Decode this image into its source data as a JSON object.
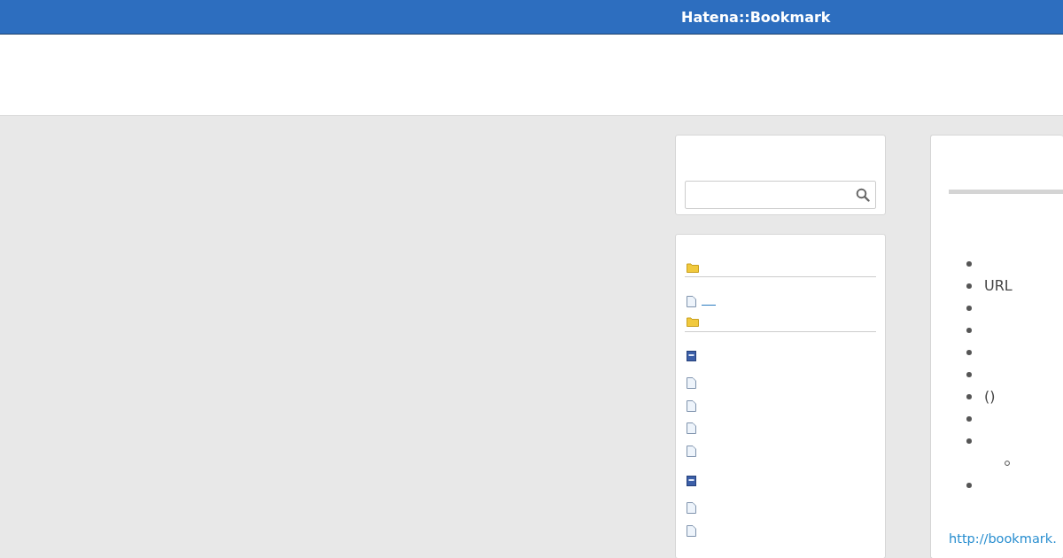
{
  "header": {
    "title": "Hatena::Bookmark"
  },
  "search": {
    "kind": "search"
  },
  "sidebar": {
    "items": [
      {
        "kind": "folder"
      },
      {
        "kind": "page",
        "link": true
      },
      {
        "kind": "folder"
      },
      {
        "kind": "book"
      },
      {
        "kind": "page"
      },
      {
        "kind": "page"
      },
      {
        "kind": "page"
      },
      {
        "kind": "page"
      },
      {
        "kind": "book"
      },
      {
        "kind": "page"
      },
      {
        "kind": "page"
      }
    ]
  },
  "main": {
    "bullets": [
      {
        "kind": "empty"
      },
      {
        "kind": "text",
        "text": "URL"
      },
      {
        "kind": "empty"
      },
      {
        "kind": "empty"
      },
      {
        "kind": "empty"
      },
      {
        "kind": "empty"
      },
      {
        "kind": "text",
        "text": "()"
      },
      {
        "kind": "empty"
      },
      {
        "kind": "empty",
        "children": [
          {
            "kind": "empty"
          }
        ]
      },
      {
        "kind": "empty"
      }
    ],
    "link": "http://bookmark."
  }
}
